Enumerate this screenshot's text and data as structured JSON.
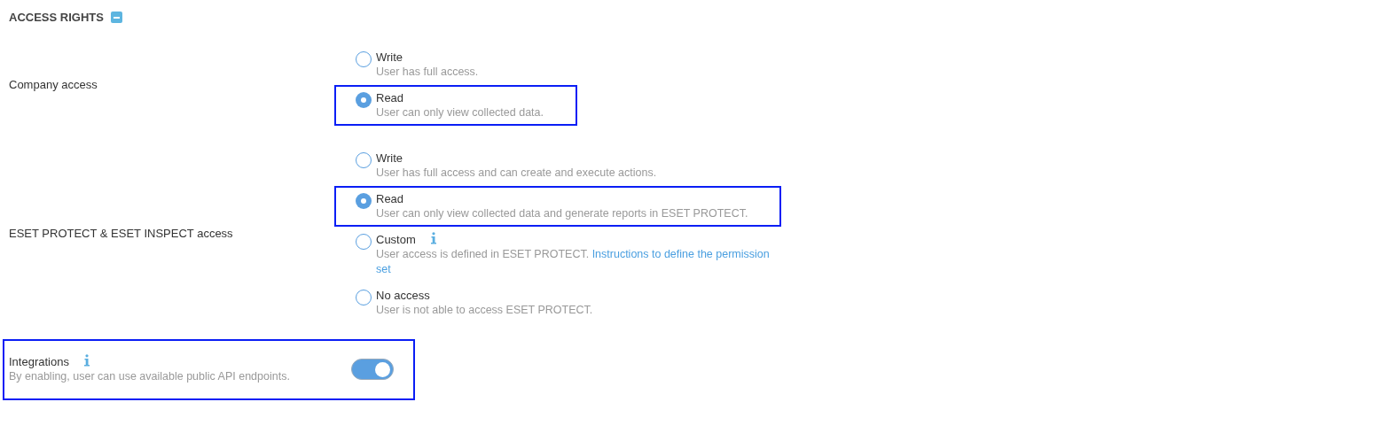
{
  "section": {
    "title": "ACCESS RIGHTS",
    "expanded": true
  },
  "groups": [
    {
      "label": "Company access",
      "options": [
        {
          "title": "Write",
          "description": "User has full access.",
          "selected": false,
          "highlighted": false
        },
        {
          "title": "Read",
          "description": "User can only view collected data.",
          "selected": true,
          "highlighted": true
        }
      ]
    },
    {
      "label": "ESET PROTECT & ESET INSPECT access",
      "options": [
        {
          "title": "Write",
          "description": "User has full access and can create and execute actions.",
          "selected": false,
          "highlighted": false
        },
        {
          "title": "Read",
          "description": "User can only view collected data and generate reports in ESET PROTECT.",
          "selected": true,
          "highlighted": true
        },
        {
          "title": "Custom",
          "info": true,
          "description": "User access is defined in ESET PROTECT.",
          "link_lines": [
            "Instructions to define the permission",
            "set"
          ],
          "selected": false,
          "highlighted": false
        },
        {
          "title": "No access",
          "description": "User is not able to access ESET PROTECT.",
          "selected": false,
          "highlighted": false
        }
      ]
    }
  ],
  "integrations": {
    "label": "Integrations",
    "info": true,
    "description": "By enabling, user can use available public API endpoints.",
    "on": true,
    "highlighted": true
  }
}
